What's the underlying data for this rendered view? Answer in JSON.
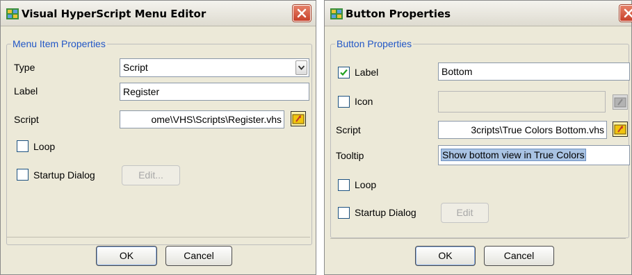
{
  "menu_editor": {
    "title": "Visual HyperScript Menu Editor",
    "group_title": "Menu Item Properties",
    "type_label": "Type",
    "type_value": "Script",
    "label_label": "Label",
    "label_value": "Register",
    "script_label": "Script",
    "script_value": "ome\\VHS\\Scripts\\Register.vhs",
    "loop_label": "Loop",
    "loop_checked": false,
    "startup_label": "Startup Dialog",
    "startup_checked": false,
    "edit_button": "Edit...",
    "ok_button": "OK",
    "cancel_button": "Cancel"
  },
  "button_properties": {
    "title": "Button Properties",
    "group_title": "Button Properties",
    "label_label": "Label",
    "label_checked": true,
    "label_value": "Bottom",
    "icon_label": "Icon",
    "icon_checked": false,
    "icon_value": "",
    "script_label": "Script",
    "script_value": "3cripts\\True Colors Bottom.vhs",
    "tooltip_label": "Tooltip",
    "tooltip_value": "Show bottom view in True Colors",
    "loop_label": "Loop",
    "loop_checked": false,
    "startup_label": "Startup Dialog",
    "startup_checked": false,
    "edit_button": "Edit",
    "ok_button": "OK",
    "cancel_button": "Cancel"
  },
  "colors": {
    "legend_blue": "#2156c6",
    "dialog_bg": "#ece9d8",
    "close_red": "#c8402a",
    "selection": "#a9c3e3"
  }
}
